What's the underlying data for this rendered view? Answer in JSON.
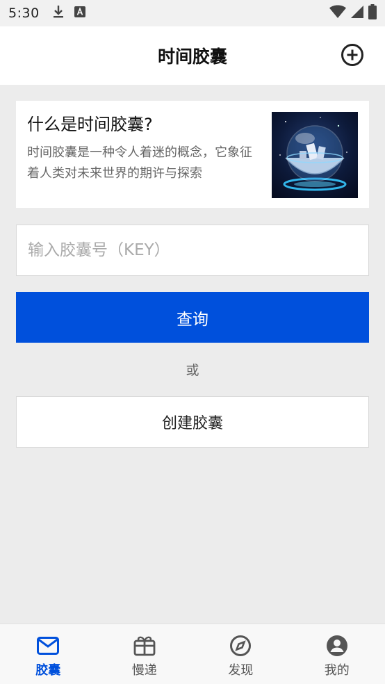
{
  "status_bar": {
    "time": "5:30",
    "icons": [
      "download-icon",
      "a-notification-icon",
      "wifi-icon",
      "signal-icon",
      "battery-icon"
    ]
  },
  "header": {
    "title": "时间胶囊",
    "add_icon": "plus-circle-icon"
  },
  "intro": {
    "title": "什么是时间胶囊?",
    "body": "时间胶囊是一种令人着迷的概念，它象征着人类对未来世界的期许与探索",
    "image": "crystal-capsule-image"
  },
  "search": {
    "placeholder": "输入胶囊号（KEY）",
    "value": ""
  },
  "query_button": "查询",
  "or_text": "或",
  "create_button": "创建胶囊",
  "bottom_nav": {
    "items": [
      {
        "label": "胶囊",
        "icon": "mail-icon",
        "active": true
      },
      {
        "label": "慢递",
        "icon": "gift-box-icon",
        "active": false
      },
      {
        "label": "发现",
        "icon": "compass-icon",
        "active": false
      },
      {
        "label": "我的",
        "icon": "user-icon",
        "active": false
      }
    ]
  },
  "colors": {
    "accent": "#0050dc",
    "background": "#ececec"
  }
}
